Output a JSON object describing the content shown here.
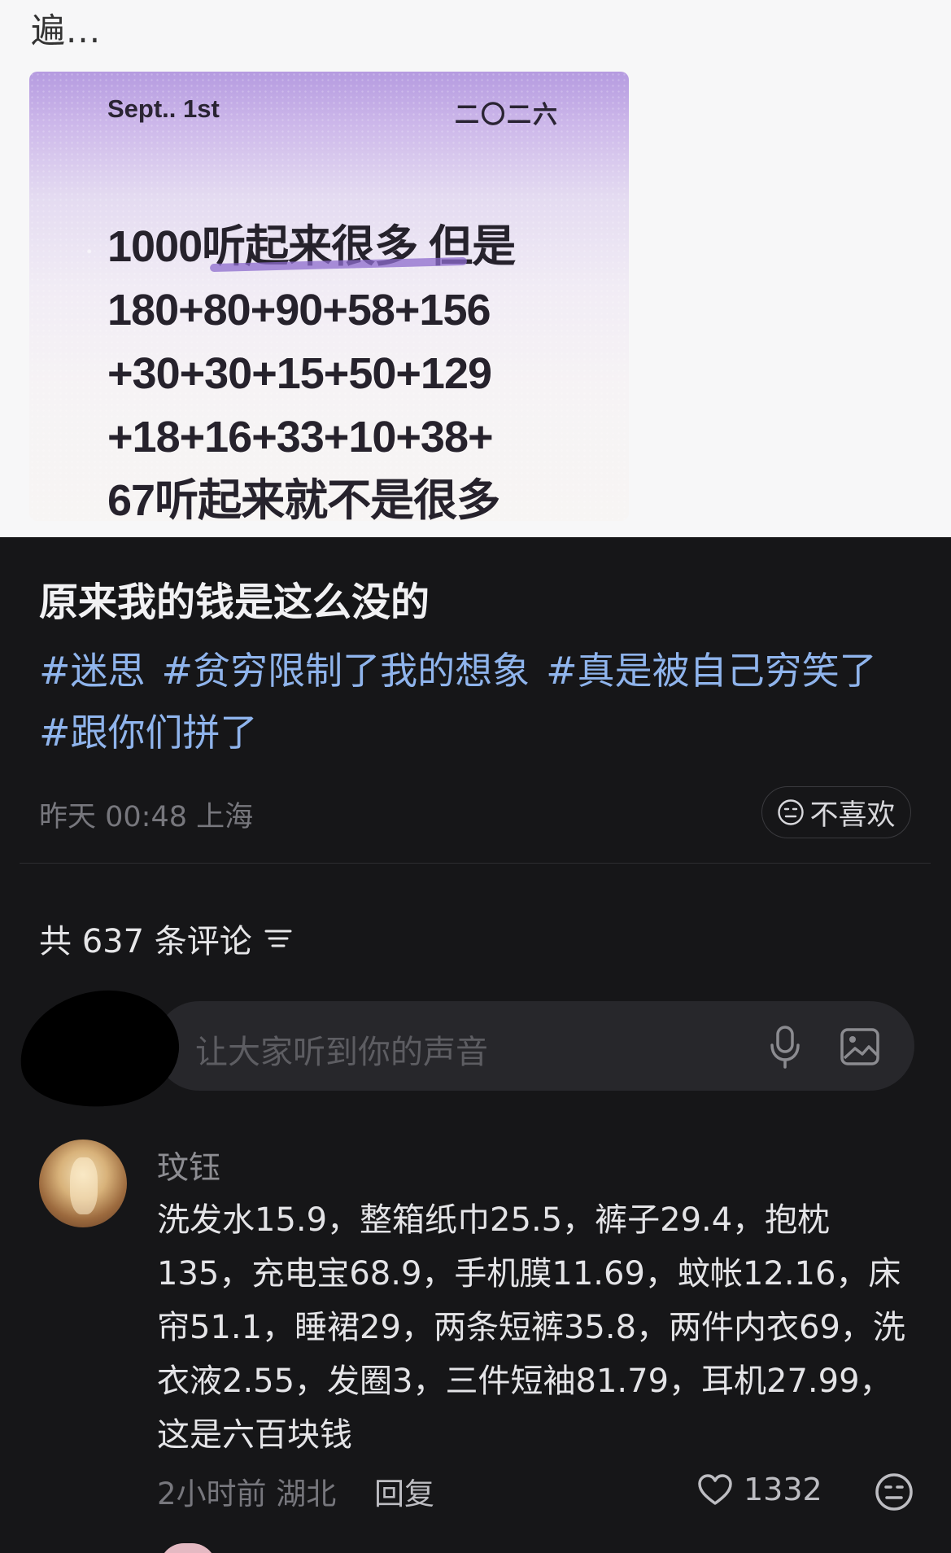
{
  "previous_text": "遍...",
  "image_card": {
    "date": "Sept.. 1st",
    "year": "二〇二六",
    "lines": [
      "1000听起来很多 但是",
      "180+80+90+58+156",
      "+30+30+15+50+129",
      "+18+16+33+10+38+",
      "67听起来就不是很多"
    ]
  },
  "post": {
    "title": "原来我的钱是这么没的",
    "hashtags": [
      "#迷思",
      "#贫穷限制了我的想象",
      "#真是被自己穷笑了",
      "#跟你们拼了"
    ],
    "meta": "昨天 00:48 上海",
    "dislike_label": "不喜欢"
  },
  "comments_header": {
    "count_text": "共 637 条评论"
  },
  "comment_input": {
    "placeholder": "让大家听到你的声音"
  },
  "comment": {
    "username": "玟钰",
    "body": "洗发水15.9，整箱纸巾25.5，裤子29.4，抱枕135，充电宝68.9，手机膜11.69，蚊帐12.16，床帘51.1，睡裙29，两条短裤35.8，两件内衣69，洗衣液2.55，发圈3，三件短袖81.79，耳机27.99，这是六百块钱",
    "time_location": "2小时前 湖北",
    "reply_label": "回复",
    "likes": "1332"
  },
  "icons": {
    "dislike": "neutral-face-icon",
    "sort": "sort-lines-icon",
    "mic": "microphone-icon",
    "image": "image-icon",
    "like": "heart-icon",
    "emoji": "neutral-face-icon"
  }
}
